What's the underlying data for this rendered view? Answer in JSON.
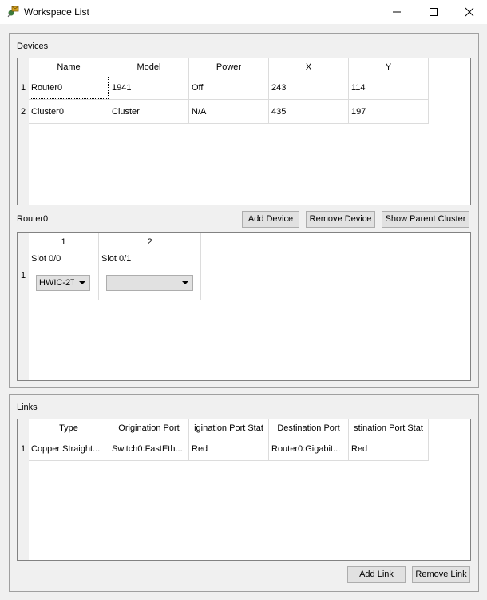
{
  "window": {
    "title": "Workspace List",
    "icon": "packet-tracer-app-icon",
    "controls": {
      "minimize": "minimize-icon",
      "maximize": "maximize-icon",
      "close": "close-icon"
    }
  },
  "devices": {
    "group_label": "Devices",
    "columns": [
      "Name",
      "Model",
      "Power",
      "X",
      "Y"
    ],
    "rows": [
      {
        "num": "1",
        "cells": [
          "Router0",
          "1941",
          "Off",
          "243",
          "114"
        ]
      },
      {
        "num": "2",
        "cells": [
          "Cluster0",
          "Cluster",
          "N/A",
          "435",
          "197"
        ]
      }
    ],
    "selected_device_label": "Router0",
    "buttons": {
      "add_device": "Add Device",
      "remove_device": "Remove Device",
      "show_parent_cluster": "Show Parent Cluster"
    },
    "slots": {
      "columns": [
        "1",
        "2"
      ],
      "row_num": "1",
      "slots": [
        {
          "label": "Slot 0/0",
          "value": "HWIC-2T"
        },
        {
          "label": "Slot 0/1",
          "value": ""
        }
      ]
    }
  },
  "links": {
    "group_label": "Links",
    "columns": [
      "Type",
      "Origination Port",
      "igination Port Stat",
      "Destination Port",
      "stination Port Stat"
    ],
    "rows": [
      {
        "num": "1",
        "cells": [
          "Copper Straight...",
          "Switch0:FastEth...",
          "Red",
          "Router0:Gigabit...",
          "Red"
        ]
      }
    ],
    "buttons": {
      "add_link": "Add Link",
      "remove_link": "Remove Link"
    }
  }
}
